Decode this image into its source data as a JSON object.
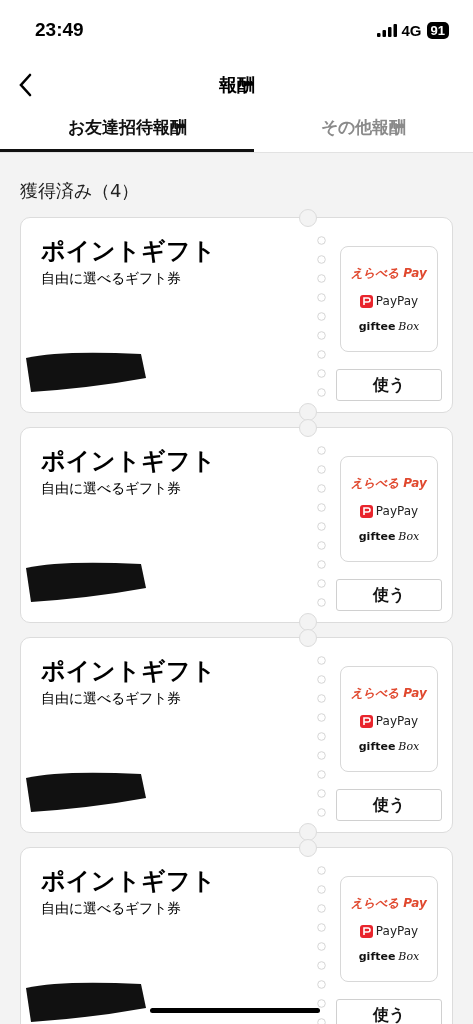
{
  "status_bar": {
    "time": "23:49",
    "network": "4G",
    "battery": "91"
  },
  "header": {
    "title": "報酬"
  },
  "tabs": [
    {
      "label": "お友達招待報酬",
      "selected": true
    },
    {
      "label": "その他報酬",
      "selected": false
    }
  ],
  "section": {
    "title": "獲得済み（4）"
  },
  "rewards": [
    {
      "title": "ポイントギフト",
      "subtitle": "自由に選べるギフト券",
      "brands": [
        "えらべる Pay",
        "PayPay",
        "giftee",
        "Box"
      ],
      "button": "使う"
    },
    {
      "title": "ポイントギフト",
      "subtitle": "自由に選べるギフト券",
      "brands": [
        "えらべる Pay",
        "PayPay",
        "giftee",
        "Box"
      ],
      "button": "使う"
    },
    {
      "title": "ポイントギフト",
      "subtitle": "自由に選べるギフト券",
      "brands": [
        "えらべる Pay",
        "PayPay",
        "giftee",
        "Box"
      ],
      "button": "使う"
    },
    {
      "title": "ポイントギフト",
      "subtitle": "自由に選べるギフト券",
      "brands": [
        "えらべる Pay",
        "PayPay",
        "giftee",
        "Box"
      ],
      "button": "使う"
    }
  ]
}
